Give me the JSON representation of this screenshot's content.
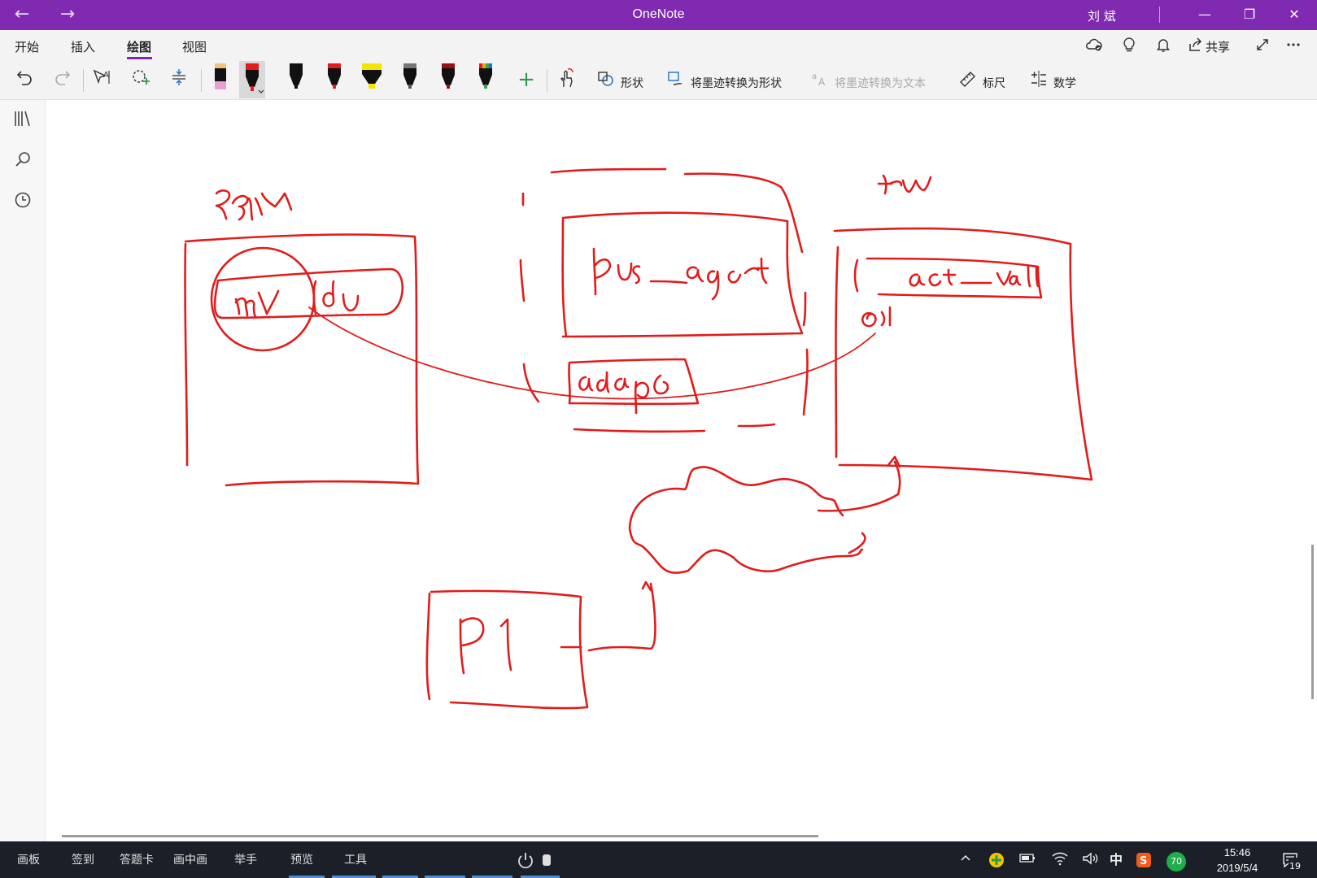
{
  "titlebar": {
    "app_title": "OneNote",
    "user": "刘 斌",
    "back_glyph": "←",
    "forward_glyph": "→",
    "minimize_glyph": "—",
    "restore_glyph": "❐",
    "close_glyph": "✕"
  },
  "tabs": [
    {
      "label": "开始"
    },
    {
      "label": "插入"
    },
    {
      "label": "绘图"
    },
    {
      "label": "视图"
    }
  ],
  "active_tab": "绘图",
  "ribbon_right": {
    "share_label": "共享"
  },
  "toolbar": {
    "tools": [
      {
        "label": "形状",
        "icon": "shapes-icon"
      },
      {
        "label": "将墨迹转换为形状",
        "icon": "ink-to-shape-icon"
      },
      {
        "label": "将墨迹转换为文本",
        "icon": "ink-to-text-icon",
        "disabled": true
      },
      {
        "label": "标尺",
        "icon": "ruler-icon"
      },
      {
        "label": "数学",
        "icon": "math-icon"
      }
    ],
    "pens": [
      {
        "name": "pencil",
        "color": "#e7a0d6"
      },
      {
        "name": "pen-red",
        "color": "#e21b1b",
        "selected": true
      },
      {
        "name": "pen-black",
        "color": "#111111"
      },
      {
        "name": "pen-red-2",
        "color": "#e21b1b"
      },
      {
        "name": "highlighter-yellow",
        "color": "#f5e400"
      },
      {
        "name": "pen-galaxy",
        "color": "#555555"
      },
      {
        "name": "pen-dark-red",
        "color": "#9a1010"
      },
      {
        "name": "pen-rainbow",
        "color": "#3aa35a"
      }
    ],
    "accent": "#7f2ab0"
  },
  "canvas": {
    "ink_color": "#e21b1b",
    "handwriting": [
      "RGM",
      "FW",
      "mV",
      "du",
      "bus_agent",
      "adapt",
      "act_vall",
      "P1"
    ]
  },
  "taskbar": {
    "apps": [
      {
        "label": "画板"
      },
      {
        "label": "签到"
      },
      {
        "label": "答题卡"
      },
      {
        "label": "画中画"
      },
      {
        "label": "举手"
      },
      {
        "label": "预览"
      },
      {
        "label": "工具"
      }
    ],
    "tray": {
      "ime": "中",
      "badge_number": "70",
      "time": "15:46",
      "date": "2019/5/4",
      "notifications": "19"
    }
  }
}
